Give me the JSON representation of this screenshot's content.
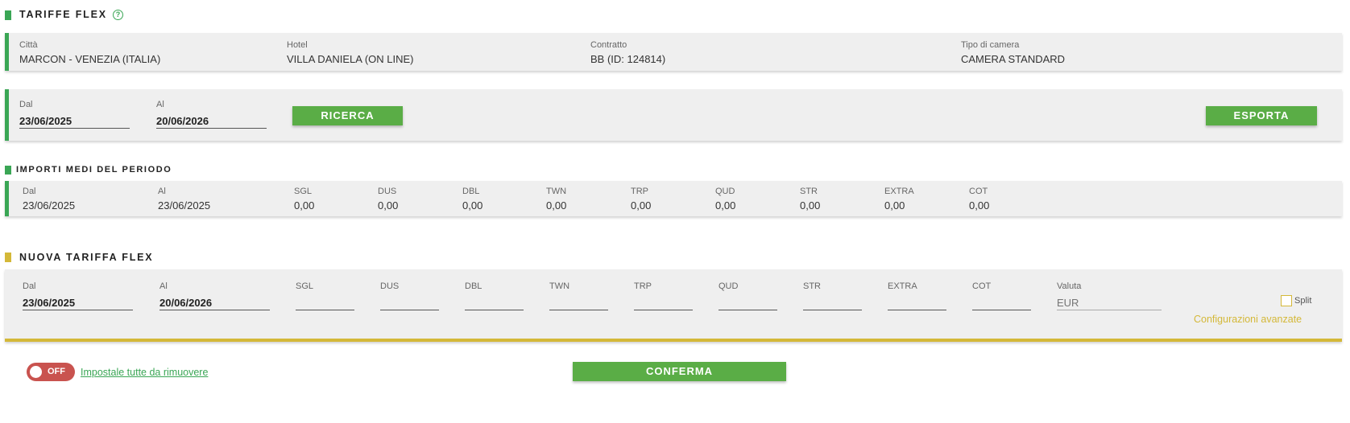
{
  "header": {
    "title": "TARIFFE FLEX",
    "help_icon": "?"
  },
  "info": {
    "city": {
      "label": "Città",
      "value": "MARCON - VENEZIA (ITALIA)"
    },
    "hotel": {
      "label": "Hotel",
      "value": "VILLA DANIELA (ON LINE)"
    },
    "contract": {
      "label": "Contratto",
      "value": "BB (ID: 124814)"
    },
    "room": {
      "label": "Tipo di camera",
      "value": "CAMERA STANDARD"
    }
  },
  "search": {
    "from_label": "Dal",
    "from_value": "23/06/2025",
    "to_label": "Al",
    "to_value": "20/06/2026",
    "search_button": "RICERCA",
    "export_button": "ESPORTA"
  },
  "averages": {
    "title": "IMPORTI MEDI DEL PERIODO",
    "from_label": "Dal",
    "from_value": "23/06/2025",
    "to_label": "Al",
    "to_value": "23/06/2025",
    "columns": [
      {
        "label": "SGL",
        "value": "0,00"
      },
      {
        "label": "DUS",
        "value": "0,00"
      },
      {
        "label": "DBL",
        "value": "0,00"
      },
      {
        "label": "TWN",
        "value": "0,00"
      },
      {
        "label": "TRP",
        "value": "0,00"
      },
      {
        "label": "QUD",
        "value": "0,00"
      },
      {
        "label": "STR",
        "value": "0,00"
      },
      {
        "label": "EXTRA",
        "value": "0,00"
      },
      {
        "label": "COT",
        "value": "0,00"
      }
    ]
  },
  "new_rate": {
    "title": "NUOVA TARIFFA FLEX",
    "from_label": "Dal",
    "from_value": "23/06/2025",
    "to_label": "Al",
    "to_value": "20/06/2026",
    "columns": [
      "SGL",
      "DUS",
      "DBL",
      "TWN",
      "TRP",
      "QUD",
      "STR",
      "EXTRA",
      "COT"
    ],
    "currency_label": "Valuta",
    "currency_placeholder": "EUR",
    "split_label": "Split",
    "advanced_link": "Configurazioni avanzate"
  },
  "footer": {
    "toggle_state": "OFF",
    "remove_all_link": "Impostale tutte da rimuovere",
    "confirm_button": "CONFERMA"
  },
  "colors": {
    "accent": "#3aa655",
    "button": "#5aad46",
    "warning": "#d4b838",
    "toggle_off": "#c9534f"
  }
}
